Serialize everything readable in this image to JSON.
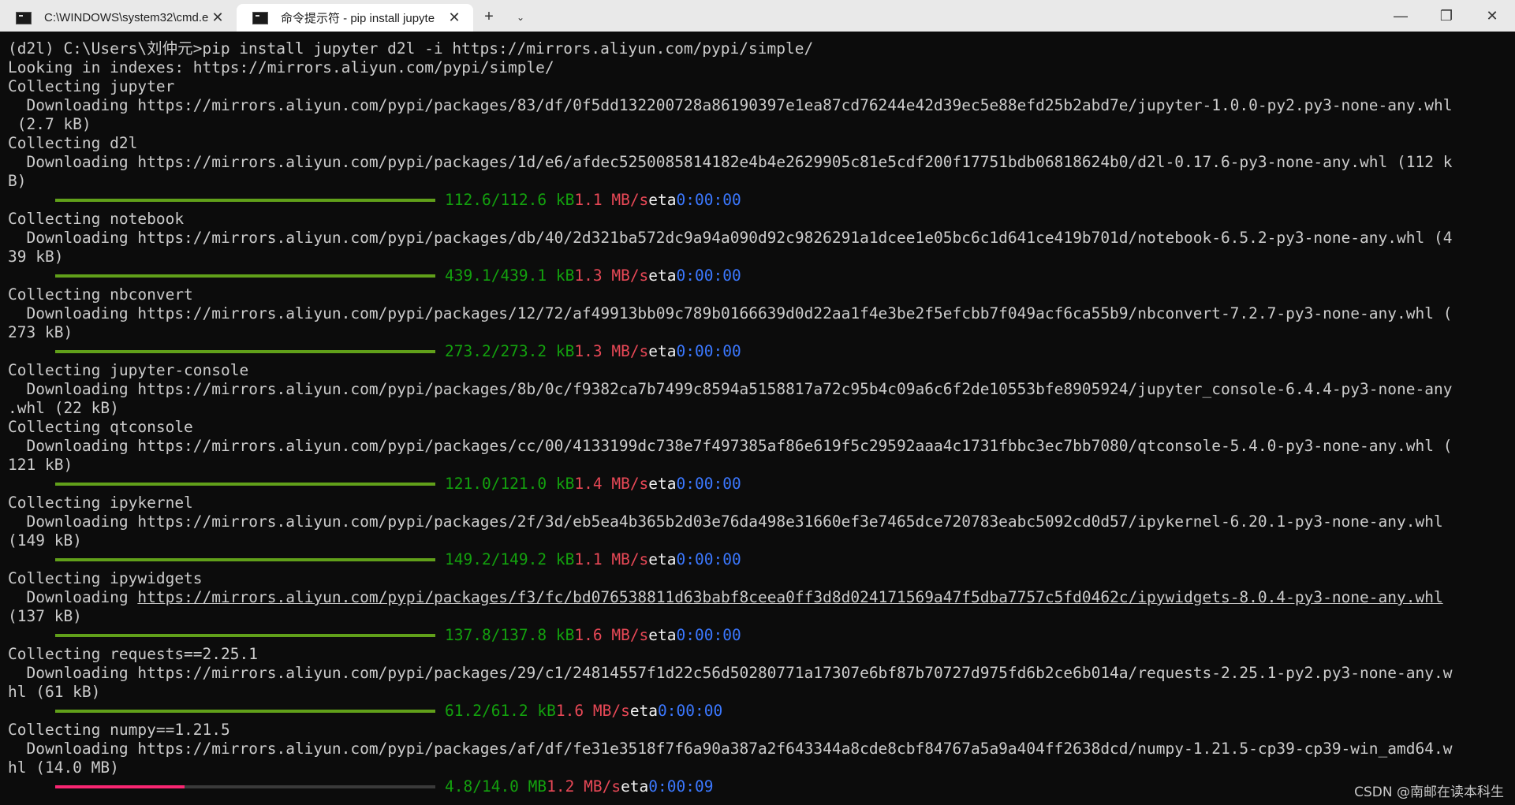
{
  "titlebar": {
    "tabs": [
      {
        "title": "C:\\WINDOWS\\system32\\cmd.e",
        "close": "✕"
      },
      {
        "title": "命令提示符 - pip  install jupyte",
        "close": "✕"
      }
    ],
    "new_tab": "+",
    "dropdown": "⌄",
    "minimize": "—",
    "maximize": "❐",
    "close": "✕"
  },
  "terminal": {
    "lines": [
      {
        "type": "text",
        "text": "(d2l) C:\\Users\\刘仲元>pip install jupyter d2l -i https://mirrors.aliyun.com/pypi/simple/"
      },
      {
        "type": "text",
        "text": "Looking in indexes: https://mirrors.aliyun.com/pypi/simple/"
      },
      {
        "type": "text",
        "text": "Collecting jupyter"
      },
      {
        "type": "text",
        "text": "  Downloading https://mirrors.aliyun.com/pypi/packages/83/df/0f5dd132200728a86190397e1ea87cd76244e42d39ec5e88efd25b2abd7e/jupyter-1.0.0-py2.py3-none-any.whl"
      },
      {
        "type": "text",
        "text": " (2.7 kB)"
      },
      {
        "type": "text",
        "text": "Collecting d2l"
      },
      {
        "type": "text",
        "text": "  Downloading https://mirrors.aliyun.com/pypi/packages/1d/e6/afdec5250085814182e4b4e2629905c81e5cdf200f17751bdb06818624b0/d2l-0.17.6-py3-none-any.whl (112 k"
      },
      {
        "type": "text",
        "text": "B)"
      },
      {
        "type": "progress",
        "progress": 1.0,
        "color": "#61a01a",
        "size": "112.6/112.6 kB",
        "speed": "1.1 MB/s",
        "eta_label": "eta",
        "eta": "0:00:00"
      },
      {
        "type": "text",
        "text": "Collecting notebook"
      },
      {
        "type": "text",
        "text": "  Downloading https://mirrors.aliyun.com/pypi/packages/db/40/2d321ba572dc9a94a090d92c9826291a1dcee1e05bc6c1d641ce419b701d/notebook-6.5.2-py3-none-any.whl (4"
      },
      {
        "type": "text",
        "text": "39 kB)"
      },
      {
        "type": "progress",
        "progress": 1.0,
        "color": "#61a01a",
        "size": "439.1/439.1 kB",
        "speed": "1.3 MB/s",
        "eta_label": "eta",
        "eta": "0:00:00"
      },
      {
        "type": "text",
        "text": "Collecting nbconvert"
      },
      {
        "type": "text",
        "text": "  Downloading https://mirrors.aliyun.com/pypi/packages/12/72/af49913bb09c789b0166639d0d22aa1f4e3be2f5efcbb7f049acf6ca55b9/nbconvert-7.2.7-py3-none-any.whl ("
      },
      {
        "type": "text",
        "text": "273 kB)"
      },
      {
        "type": "progress",
        "progress": 1.0,
        "color": "#61a01a",
        "size": "273.2/273.2 kB",
        "speed": "1.3 MB/s",
        "eta_label": "eta",
        "eta": "0:00:00"
      },
      {
        "type": "text",
        "text": "Collecting jupyter-console"
      },
      {
        "type": "text",
        "text": "  Downloading https://mirrors.aliyun.com/pypi/packages/8b/0c/f9382ca7b7499c8594a5158817a72c95b4c09a6c6f2de10553bfe8905924/jupyter_console-6.4.4-py3-none-any"
      },
      {
        "type": "text",
        "text": ".whl (22 kB)"
      },
      {
        "type": "text",
        "text": "Collecting qtconsole"
      },
      {
        "type": "text",
        "text": "  Downloading https://mirrors.aliyun.com/pypi/packages/cc/00/4133199dc738e7f497385af86e619f5c29592aaa4c1731fbbc3ec7bb7080/qtconsole-5.4.0-py3-none-any.whl ("
      },
      {
        "type": "text",
        "text": "121 kB)"
      },
      {
        "type": "progress",
        "progress": 1.0,
        "color": "#61a01a",
        "size": "121.0/121.0 kB",
        "speed": "1.4 MB/s",
        "eta_label": "eta",
        "eta": "0:00:00"
      },
      {
        "type": "text",
        "text": "Collecting ipykernel"
      },
      {
        "type": "text",
        "text": "  Downloading https://mirrors.aliyun.com/pypi/packages/2f/3d/eb5ea4b365b2d03e76da498e31660ef3e7465dce720783eabc5092cd0d57/ipykernel-6.20.1-py3-none-any.whl"
      },
      {
        "type": "text",
        "text": "(149 kB)"
      },
      {
        "type": "progress",
        "progress": 1.0,
        "color": "#61a01a",
        "size": "149.2/149.2 kB",
        "speed": "1.1 MB/s",
        "eta_label": "eta",
        "eta": "0:00:00"
      },
      {
        "type": "text",
        "text": "Collecting ipywidgets"
      },
      {
        "type": "link",
        "prefix": "  Downloading ",
        "link": "https://mirrors.aliyun.com/pypi/packages/f3/fc/bd076538811d63babf8ceea0ff3d8d024171569a47f5dba7757c5fd0462c/ipywidgets-8.0.4-py3-none-any.whl"
      },
      {
        "type": "text",
        "text": "(137 kB)"
      },
      {
        "type": "progress",
        "progress": 1.0,
        "color": "#61a01a",
        "size": "137.8/137.8 kB",
        "speed": "1.6 MB/s",
        "eta_label": "eta",
        "eta": "0:00:00"
      },
      {
        "type": "text",
        "text": "Collecting requests==2.25.1"
      },
      {
        "type": "text",
        "text": "  Downloading https://mirrors.aliyun.com/pypi/packages/29/c1/24814557f1d22c56d50280771a17307e6bf87b70727d975fd6b2ce6b014a/requests-2.25.1-py2.py3-none-any.w"
      },
      {
        "type": "text",
        "text": "hl (61 kB)"
      },
      {
        "type": "progress",
        "progress": 1.0,
        "color": "#61a01a",
        "size": "61.2/61.2 kB",
        "speed": "1.6 MB/s",
        "eta_label": "eta",
        "eta": "0:00:00"
      },
      {
        "type": "text",
        "text": "Collecting numpy==1.21.5"
      },
      {
        "type": "text",
        "text": "  Downloading https://mirrors.aliyun.com/pypi/packages/af/df/fe31e3518f7f6a90a387a2f643344a8cde8cbf84767a5a9a404ff2638dcd/numpy-1.21.5-cp39-cp39-win_amd64.w"
      },
      {
        "type": "text",
        "text": "hl (14.0 MB)"
      },
      {
        "type": "progress",
        "progress": 0.34,
        "color": "#f92672",
        "size": "4.8/14.0 MB",
        "speed": "1.2 MB/s",
        "eta_label": "eta",
        "eta": "0:00:09"
      }
    ]
  },
  "watermark": "CSDN @南邮在读本科生"
}
